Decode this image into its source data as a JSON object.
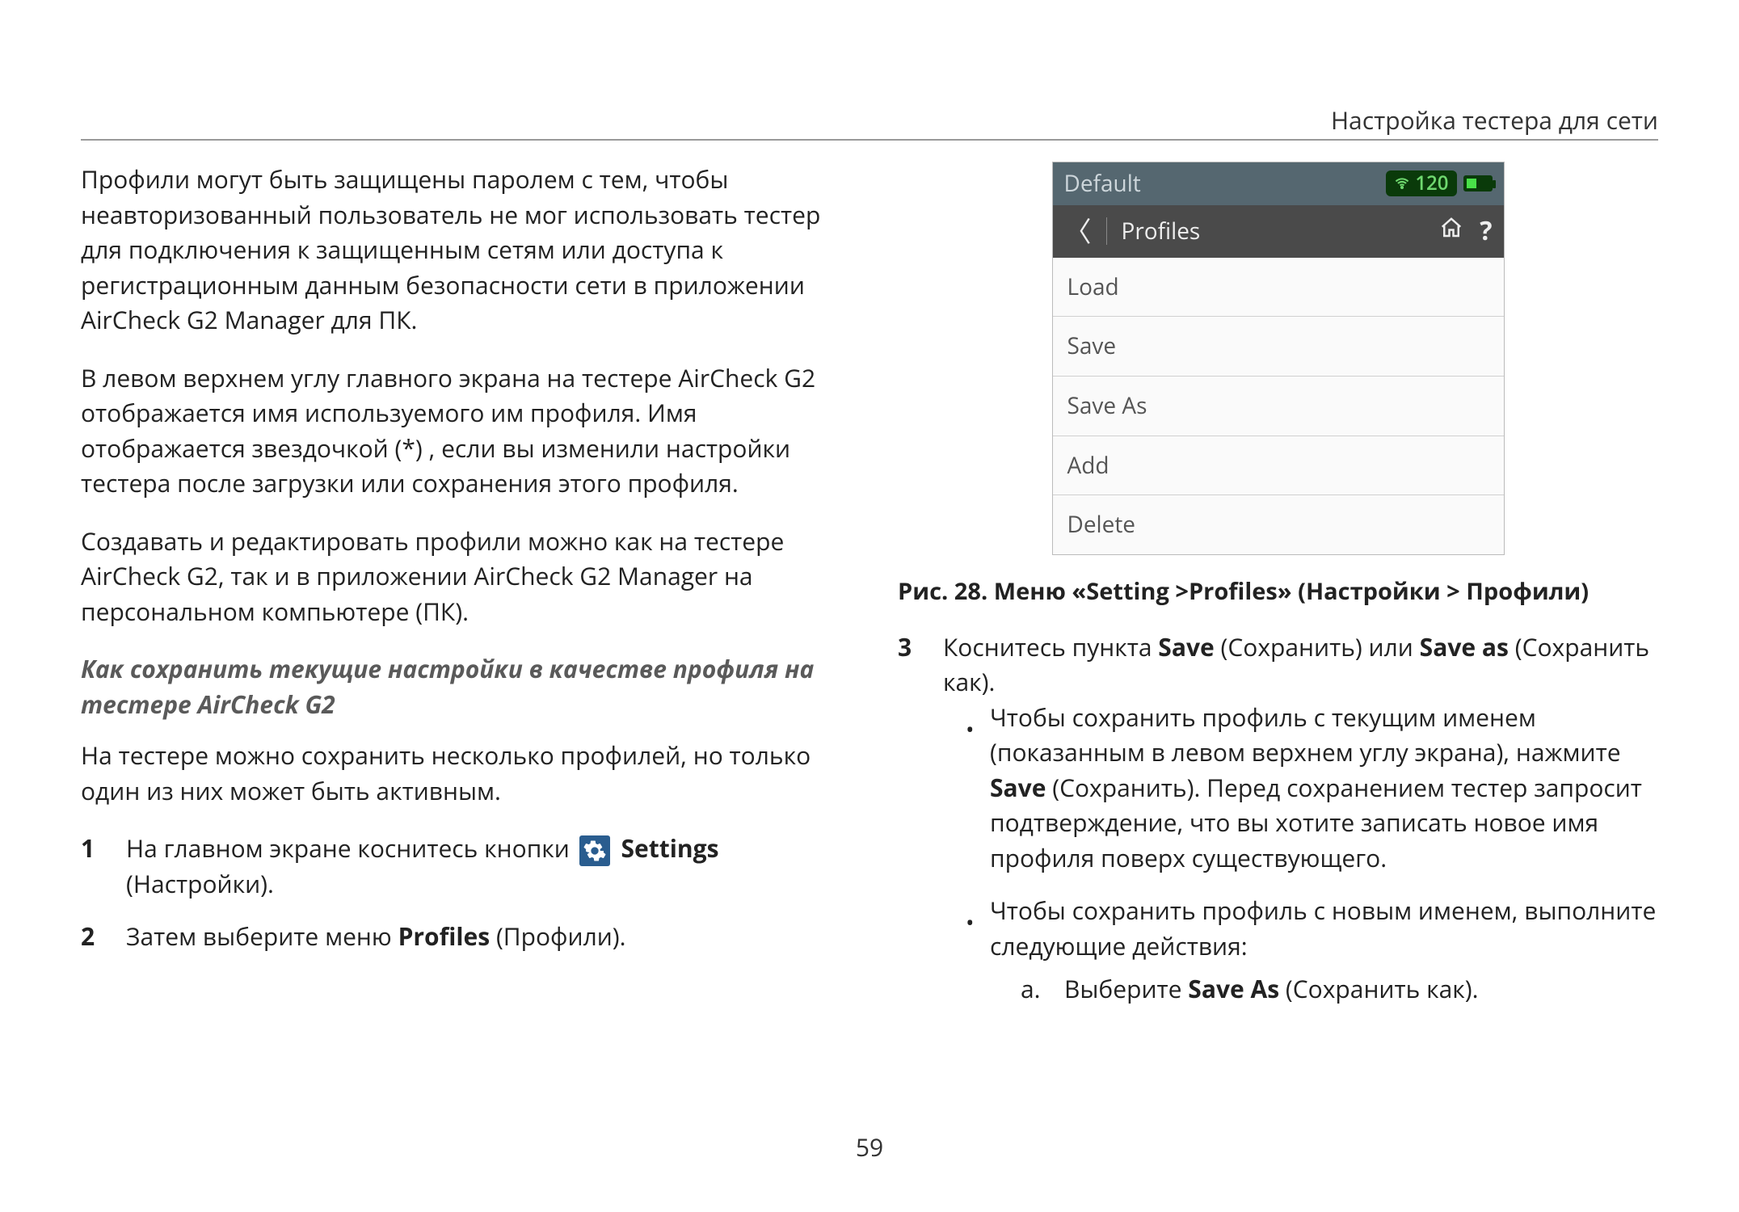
{
  "header": {
    "section_title": "Настройка тестера для сети"
  },
  "left": {
    "p1": "Профили могут быть защищены паролем с тем, чтобы неавторизованный пользователь не мог использовать тестер для подключения к защищенным сетям или доступа к регистрационным данным безопасности сети в приложении AirCheck G2 Manager для ПК.",
    "p2": "В левом верхнем углу главного экрана на тестере AirCheck G2 отображается имя используемого им профиля. Имя отображается звездочкой (*) , если вы изменили настройки тестера после загрузки или сохранения этого профиля.",
    "p3": "Создавать и редактировать профили можно как на тестере AirCheck G2, так и в приложении AirCheck G2 Manager на персональном компьютере (ПК).",
    "subhead": "Как сохранить текущие настройки в качестве профиля на тестере AirCheck G2",
    "p4": "На тестере можно сохранить несколько профилей, но только один из них может быть активным.",
    "step1_num": "1",
    "step1_pre": "На главном экране коснитесь кнопки ",
    "step1_settings": "Settings",
    "step1_post": " (Настройки).",
    "step2_num": "2",
    "step2_pre": "Затем выберите меню ",
    "step2_bold": "Profiles",
    "step2_post": " (Профили)."
  },
  "device": {
    "profile_name": "Default",
    "signal_value": "120",
    "screen_title": "Profiles",
    "items": [
      "Load",
      "Save",
      "Save As",
      "Add",
      "Delete"
    ]
  },
  "right": {
    "fig_caption": "Рис. 28. Меню «Setting >Profiles» (Настройки > Профили)",
    "step3_num": "3",
    "step3_a": "Коснитесь пункта ",
    "step3_b": "Save",
    "step3_c": " (Сохранить) или ",
    "step3_d": "Save as",
    "step3_e": " (Сохранить как).",
    "b1_a": "Чтобы сохранить профиль с текущим именем (показанным в левом верхнем углу экрана), нажмите ",
    "b1_b": "Save",
    "b1_c": " (Сохранить). Перед сохранением тестер запросит подтверждение, что вы хотите записать новое имя профиля поверх существующего.",
    "b2": "Чтобы сохранить профиль с новым именем, выполните следующие действия:",
    "b2a_marker": "a.",
    "b2a_a": "Выберите ",
    "b2a_b": "Save As",
    "b2a_c": " (Сохранить как)."
  },
  "page_number": "59"
}
